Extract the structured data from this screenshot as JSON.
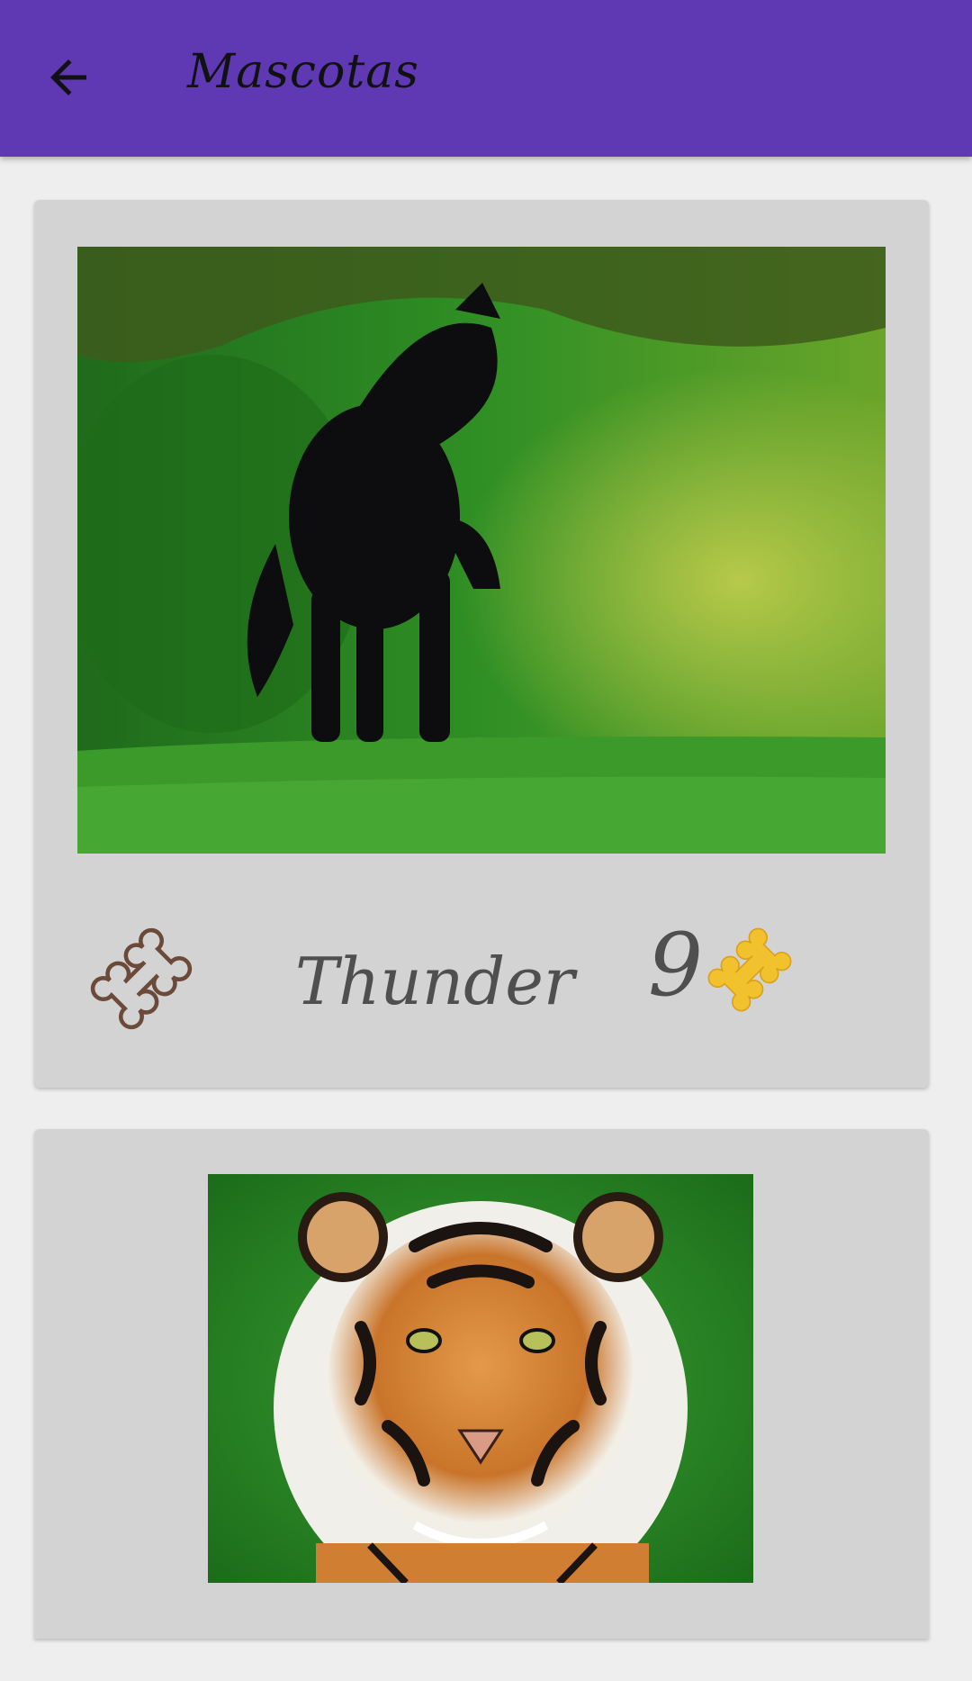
{
  "appbar": {
    "title": "Mascotas",
    "back_icon": "arrow-back-icon",
    "background": "#5f39b3"
  },
  "pets": [
    {
      "photo_subject": "horse-photo",
      "name": "Thunder",
      "rating": "9",
      "like_icon": "bone-outline-icon",
      "rating_icon": "bone-filled-icon"
    },
    {
      "photo_subject": "tiger-photo"
    }
  ],
  "colors": {
    "card": "#d3d3d3",
    "background": "#eeeeee",
    "text": "#4f4f4f",
    "bone_outline": "#6b4a3a",
    "bone_filled": "#f2c12e"
  }
}
